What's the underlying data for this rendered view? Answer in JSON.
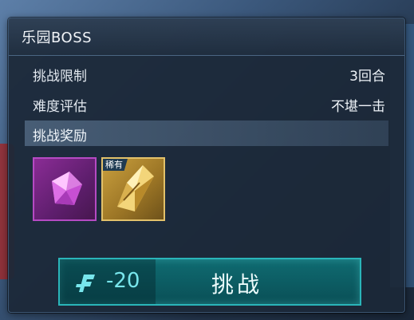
{
  "panel": {
    "title": "乐园BOSS"
  },
  "info": {
    "limit_label": "挑战限制",
    "limit_value": "3回合",
    "difficulty_label": "难度评估",
    "difficulty_value": "不堪一击"
  },
  "rewards": {
    "header": "挑战奖励",
    "items": [
      {
        "icon": "purple-crystal-icon",
        "rarity_color": "#b54ac3"
      },
      {
        "icon": "gold-shard-icon",
        "rarity_color": "#e2c16a",
        "badge": "稀有"
      }
    ]
  },
  "challenge_button": {
    "cost": "-20",
    "cost_icon": "stamina-icon",
    "label": "挑战",
    "accent_color": "#2ab5b9"
  }
}
